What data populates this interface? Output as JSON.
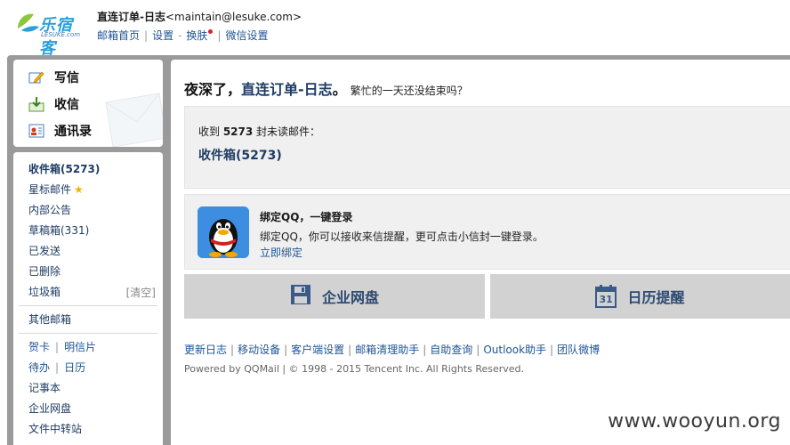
{
  "logo": {
    "text": "乐宿客",
    "sub": "LESUKE.com"
  },
  "account": {
    "name": "直连订单-日志",
    "email": "<maintain@lesuke.com>"
  },
  "top_links": [
    "邮箱首页",
    "设置",
    "换肤",
    "微信设置"
  ],
  "quick_actions": [
    {
      "label": "写信",
      "icon": "compose-icon"
    },
    {
      "label": "收信",
      "icon": "inbox-download-icon"
    },
    {
      "label": "通讯录",
      "icon": "contacts-icon"
    }
  ],
  "folders": {
    "inbox": "收件箱(5273)",
    "starred": "星标邮件",
    "notice": "内部公告",
    "drafts": "草稿箱(331)",
    "sent": "已发送",
    "deleted": "已删除",
    "junk": "垃圾箱",
    "junk_clear": "[清空]",
    "other": "其他邮箱",
    "card": "贺卡",
    "postcard": "明信片",
    "todo": "待办",
    "calendar": "日历",
    "notes": "记事本",
    "netdisk": "企业网盘",
    "transfer": "文件中转站"
  },
  "greeting": {
    "prefix": "夜深了，",
    "name": "直连订单-日志",
    "suffix": "。",
    "sub": "繁忙的一天还没结束吗？"
  },
  "unread": {
    "prefix": "收到 ",
    "count": "5273",
    "suffix": " 封未读邮件：",
    "inbox_link": "收件箱(5273)"
  },
  "qq": {
    "title": "绑定QQ，一键登录",
    "desc": "绑定QQ，你可以接收来信提醒，更可点击小信封一键登录。",
    "link": "立即绑定"
  },
  "tiles": [
    {
      "label": "企业网盘",
      "icon": "disk-icon"
    },
    {
      "label": "日历提醒",
      "icon": "calendar-icon",
      "day": "31"
    }
  ],
  "footer_links": [
    "更新日志",
    "移动设备",
    "客户端设置",
    "邮箱清理助手",
    "自助查询",
    "Outlook助手",
    "团队微博"
  ],
  "copyright": "Powered by QQMail  | © 1998 - 2015 Tencent Inc. All Rights Reserved.",
  "watermark": "www.wooyun.org",
  "colors": {
    "link": "#1e5494",
    "frame": "#9a9a9a",
    "panel": "#f0f0f0",
    "tile": "#d2d2d2"
  }
}
